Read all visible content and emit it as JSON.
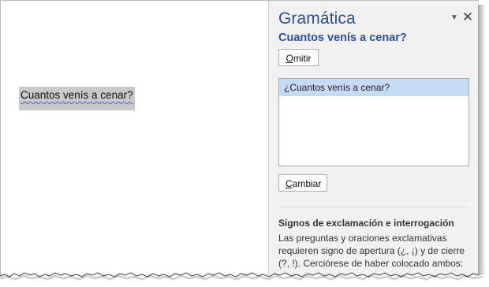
{
  "document": {
    "text": "Cuantos venís a cenar?"
  },
  "panel": {
    "title": "Gramática",
    "options_icon": "triangle-down-icon",
    "close_icon": "close-icon",
    "error_text": "Cuantos venís a cenar?",
    "omit_button_accel": "O",
    "omit_button_rest": "mitir",
    "suggestions": [
      "¿Cuantos venís a cenar?"
    ],
    "change_button_accel": "C",
    "change_button_rest": "ambiar",
    "explanation": {
      "heading": "Signos de exclamación e interrogación",
      "body": "Las preguntas y oraciones exclamativas requieren signo de apertura (¿, ¡) y de cierre (?, !). Cerciórese de haber colocado ambos:"
    }
  },
  "colors": {
    "accent": "#2f4f93",
    "selection": "#c5daf5",
    "panel_bg": "#f1f1f1",
    "highlight": "#c9c9c9",
    "squiggle": "#4a5fd6"
  }
}
